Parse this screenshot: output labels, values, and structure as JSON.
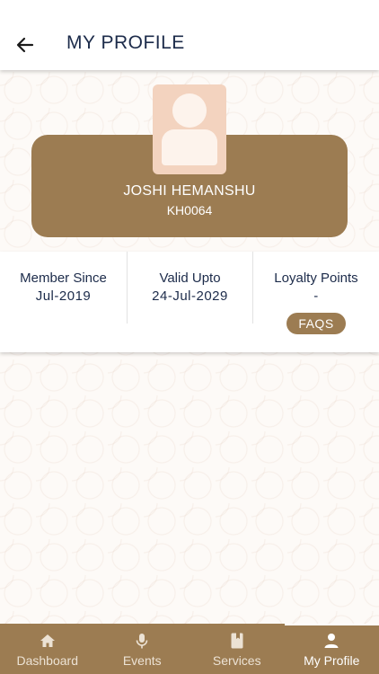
{
  "header": {
    "title": "MY PROFILE",
    "back_icon": "arrow-left-icon"
  },
  "profile": {
    "avatar_icon": "user-avatar-icon",
    "name": "JOSHI HEMANSHU",
    "member_id": "KH0064"
  },
  "stats": [
    {
      "label": "Member Since",
      "value": "Jul-2019"
    },
    {
      "label": "Valid Upto",
      "value": "24-Jul-2029"
    },
    {
      "label": "Loyalty Points",
      "value": "-"
    }
  ],
  "faqs_label": "FAQS",
  "bottom_nav": [
    {
      "label": "Dashboard",
      "icon": "home-icon",
      "active": false
    },
    {
      "label": "Events",
      "icon": "microphone-icon",
      "active": false
    },
    {
      "label": "Services",
      "icon": "book-icon",
      "active": false
    },
    {
      "label": "My Profile",
      "icon": "person-icon",
      "active": true
    }
  ],
  "colors": {
    "brand": "#9c7c52",
    "title_text": "#1c2b4a",
    "avatar_bg": "#f3d3bf"
  }
}
